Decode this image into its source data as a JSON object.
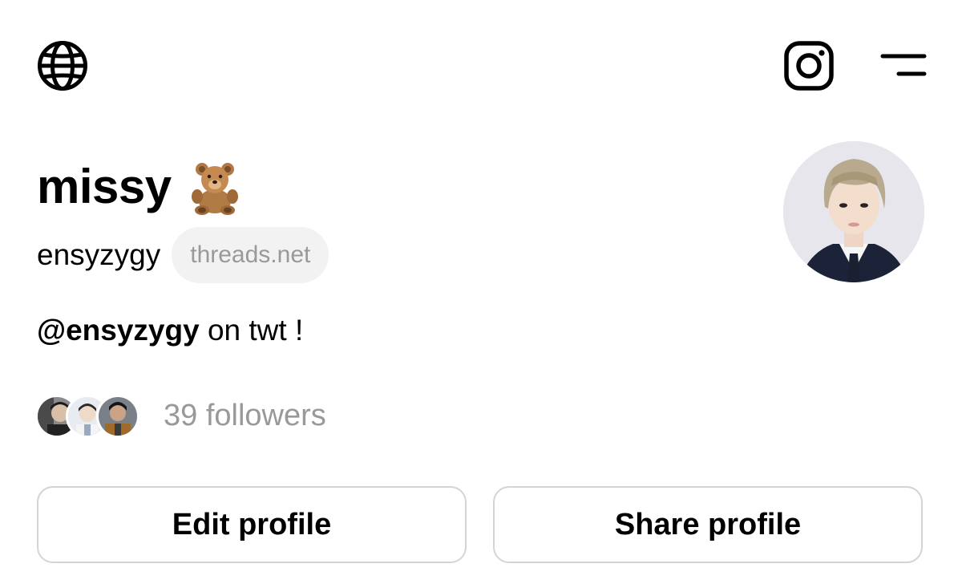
{
  "header": {
    "left_icon": "globe-icon",
    "right_icons": [
      "instagram-icon",
      "menu-icon"
    ]
  },
  "profile": {
    "display_name": "missy",
    "display_name_emoji": "teddy-bear-emoji",
    "username": "ensyzygy",
    "domain_chip": "threads.net",
    "bio_mention": "@ensyzygy",
    "bio_rest": " on twt !",
    "followers_label": "39 followers"
  },
  "actions": {
    "edit_label": "Edit profile",
    "share_label": "Share profile"
  },
  "colors": {
    "text": "#000000",
    "muted": "#999999",
    "chip_bg": "#f2f2f2",
    "button_border": "#d4d4d4",
    "background": "#ffffff"
  }
}
